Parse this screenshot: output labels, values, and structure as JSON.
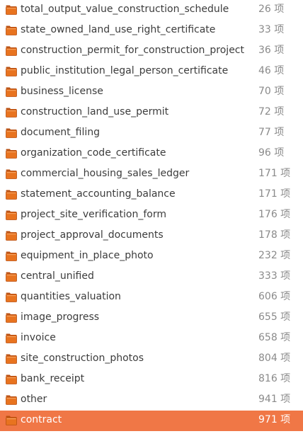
{
  "folder_list": {
    "items": [
      {
        "name": "total_output_value_construction_schedule",
        "count": "26 项"
      },
      {
        "name": "state_owned_land_use_right_certificate",
        "count": "33 项"
      },
      {
        "name": "construction_permit_for_construction_project",
        "count": "36 项"
      },
      {
        "name": "public_institution_legal_person_certificate",
        "count": "46 项"
      },
      {
        "name": "business_license",
        "count": "70 项"
      },
      {
        "name": "construction_land_use_permit",
        "count": "72 项"
      },
      {
        "name": "document_filing",
        "count": "77 项"
      },
      {
        "name": "organization_code_certificate",
        "count": "96 项"
      },
      {
        "name": "commercial_housing_sales_ledger",
        "count": "171 项"
      },
      {
        "name": "statement_accounting_balance",
        "count": "171 项"
      },
      {
        "name": "project_site_verification_form",
        "count": "176 项"
      },
      {
        "name": "project_approval_documents",
        "count": "178 项"
      },
      {
        "name": "equipment_in_place_photo",
        "count": "232 项"
      },
      {
        "name": "central_unified",
        "count": "333 项"
      },
      {
        "name": "quantities_valuation",
        "count": "606 项"
      },
      {
        "name": "image_progress",
        "count": "655 项"
      },
      {
        "name": "invoice",
        "count": "658 项"
      },
      {
        "name": "site_construction_photos",
        "count": "804 项"
      },
      {
        "name": "bank_receipt",
        "count": "816 项"
      },
      {
        "name": "other",
        "count": "941 项"
      },
      {
        "name": "contract",
        "count": "971 项"
      }
    ],
    "selected_index": 20
  },
  "icon": "folder-icon",
  "colors": {
    "selection": "#f07746",
    "folder_body": "#e8731f",
    "folder_tab": "#b94f10"
  }
}
